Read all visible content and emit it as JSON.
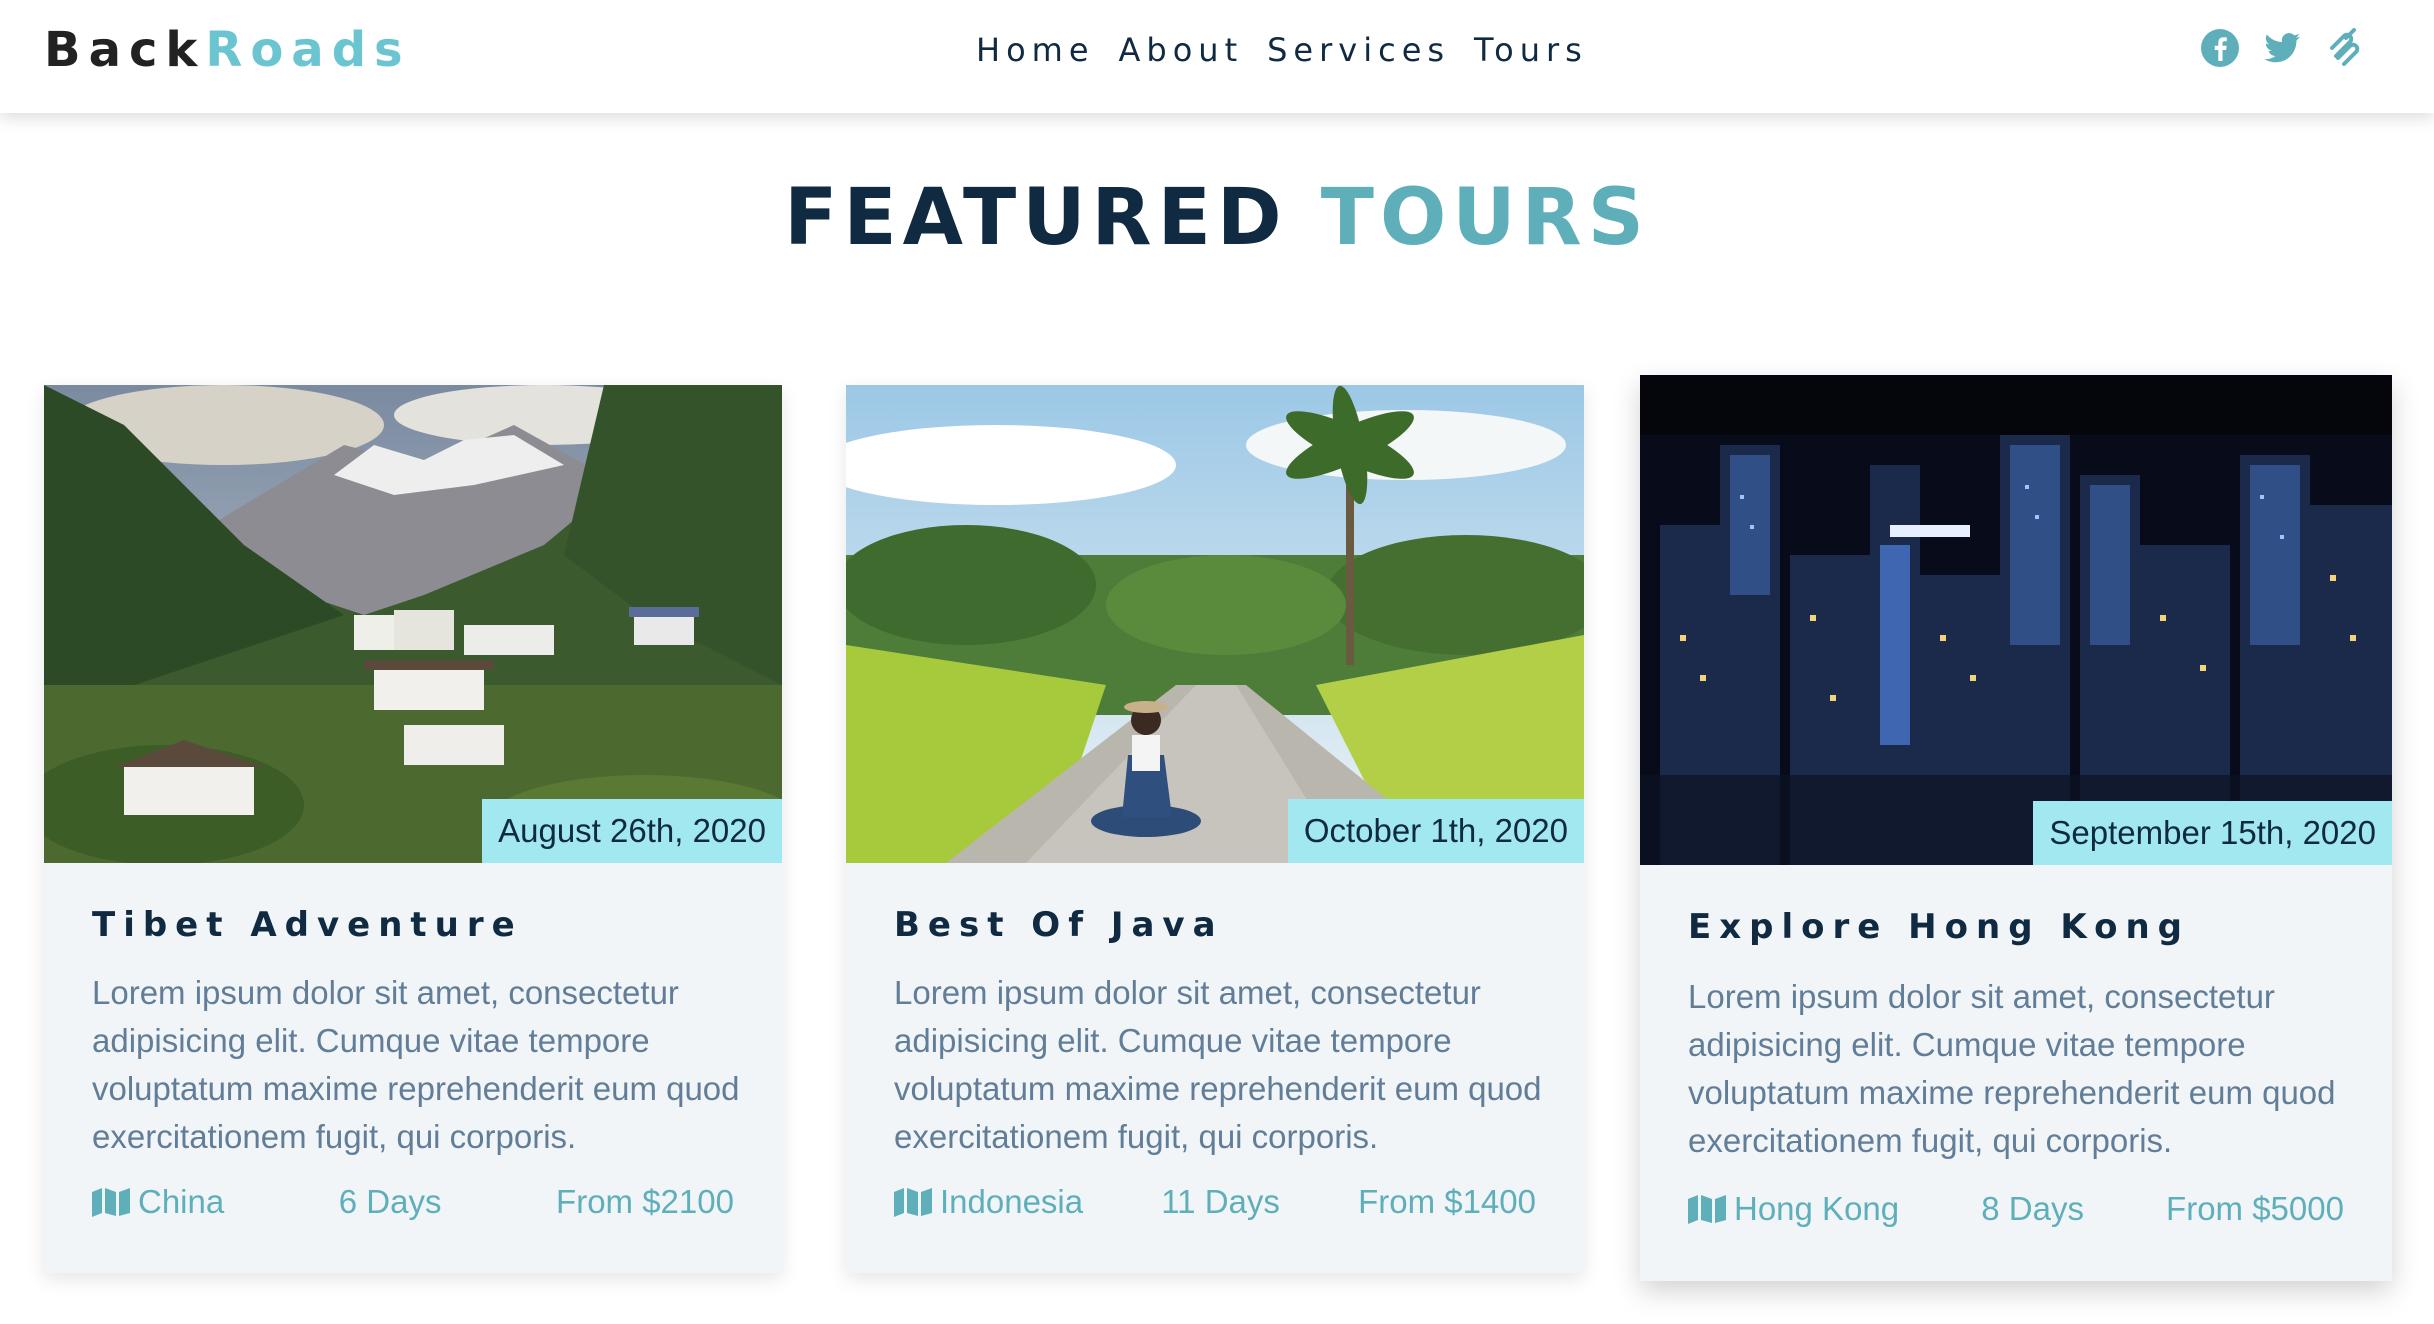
{
  "brand": {
    "part1": "Back",
    "part2": "Roads"
  },
  "nav": {
    "links": [
      "Home",
      "About",
      "Services",
      "Tours"
    ],
    "social_icons": [
      "facebook-icon",
      "twitter-icon",
      "squarespace-icon"
    ]
  },
  "colors": {
    "accent": "#5fafbb",
    "badge": "#a2e8f1",
    "dark": "#102a42",
    "text": "#617d98",
    "card_bg": "#f1f5f8"
  },
  "section": {
    "title_part1": "FEATURED",
    "title_part2": "TOURS"
  },
  "tours": [
    {
      "image": "mountain-village-photo",
      "date": "August 26th, 2020",
      "title": "Tibet Adventure",
      "text": "Lorem ipsum dolor sit amet, consectetur adipisicing elit. Cumque vitae tempore voluptatum maxime reprehenderit eum quod exercitationem fugit, qui corporis.",
      "country": "China",
      "duration": "6 Days",
      "price": "From $2100"
    },
    {
      "image": "tropical-road-photo",
      "date": "October 1th, 2020",
      "title": "Best Of Java",
      "text": "Lorem ipsum dolor sit amet, consectetur adipisicing elit. Cumque vitae tempore voluptatum maxime reprehenderit eum quod exercitationem fugit, qui corporis.",
      "country": "Indonesia",
      "duration": "11 Days",
      "price": "From $1400"
    },
    {
      "image": "night-city-photo",
      "date": "September 15th, 2020",
      "title": "Explore Hong Kong",
      "text": "Lorem ipsum dolor sit amet, consectetur adipisicing elit. Cumque vitae tempore voluptatum maxime reprehenderit eum quod exercitationem fugit, qui corporis.",
      "country": "Hong Kong",
      "duration": "8 Days",
      "price": "From $5000"
    }
  ]
}
